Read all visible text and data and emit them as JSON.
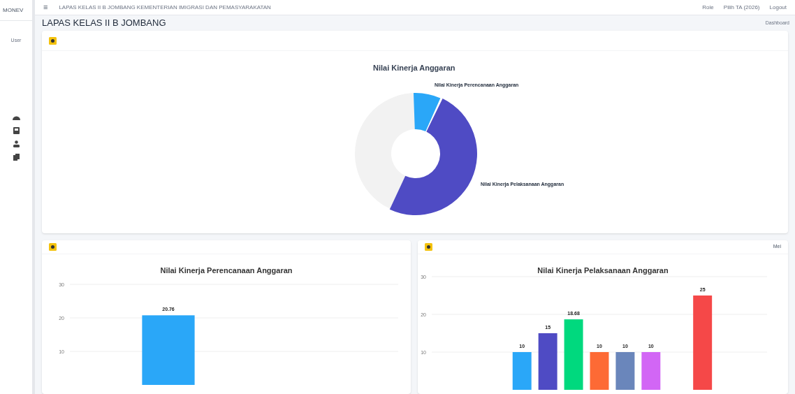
{
  "topbar": {
    "brand": "MONEV",
    "menu_glyph": "≡",
    "title": "LAPAS KELAS II B JOMBANG KEMENTERIAN IMIGRASI DAN PEMASYARAKATAN",
    "links": [
      "Role",
      "Pilih TA (2026)",
      "Logout"
    ]
  },
  "sidebar": {
    "avatar_alt": "User"
  },
  "header": {
    "title": "LAPAS KELAS II B JOMBANG",
    "breadcrumb": "Dashboard"
  },
  "donut_card": {
    "title": "Nilai Kinerja Anggaran",
    "labels": [
      "Nilai Kinerja Perencanaan Anggaran",
      "Nilai Kinerja Pelaksanaan Anggaran"
    ]
  },
  "left_card": {
    "chart_data": {
      "type": "bar",
      "title": "Nilai Kinerja Perencanaan Anggaran",
      "series": [
        {
          "color": "#2aa7f8",
          "values": [
            null,
            20.76,
            null,
            null,
            null
          ]
        }
      ],
      "ylim": [
        0,
        30
      ],
      "yticks": [
        10,
        20,
        30
      ],
      "data_labels": true
    }
  },
  "right_card": {
    "corner": "Mei",
    "chart_data": {
      "type": "bar",
      "title": "Nilai Kinerja Pelaksanaan Anggaran",
      "stacked": true,
      "series": [
        {
          "color": "#2aa7f8",
          "values": [
            null,
            null,
            null,
            10,
            null,
            null,
            null,
            null,
            null,
            null,
            null,
            null,
            null
          ]
        },
        {
          "color": "#4f4bc4",
          "values": [
            null,
            null,
            null,
            null,
            15,
            null,
            null,
            null,
            null,
            null,
            null,
            null,
            null
          ]
        },
        {
          "color": "#00d97e",
          "values": [
            null,
            null,
            null,
            null,
            null,
            18.68,
            null,
            null,
            null,
            null,
            null,
            null,
            null
          ]
        },
        {
          "color": "#fd6a35",
          "values": [
            null,
            null,
            null,
            null,
            null,
            null,
            10,
            null,
            null,
            null,
            null,
            null,
            null
          ]
        },
        {
          "color": "#6a86bb",
          "values": [
            null,
            null,
            null,
            null,
            null,
            null,
            null,
            10,
            null,
            null,
            null,
            null,
            null
          ]
        },
        {
          "color": "#d266f5",
          "values": [
            null,
            null,
            null,
            null,
            null,
            null,
            null,
            null,
            10,
            null,
            null,
            null,
            null
          ]
        },
        {
          "color": "#f54848",
          "values": [
            null,
            null,
            null,
            null,
            null,
            null,
            null,
            null,
            null,
            null,
            25,
            null,
            null
          ]
        }
      ],
      "ylim": [
        0,
        30
      ],
      "yticks": [
        10,
        20,
        30
      ],
      "data_labels": true
    }
  }
}
